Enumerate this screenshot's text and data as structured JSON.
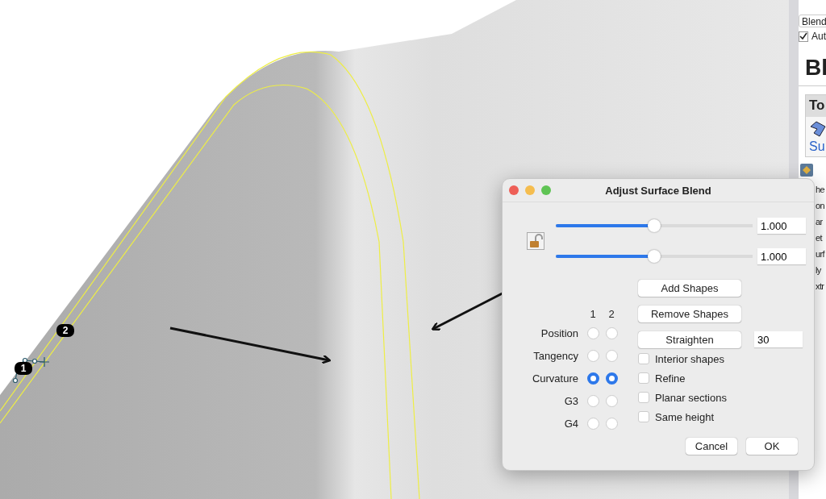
{
  "viewport": {
    "badges": [
      {
        "label": "1"
      },
      {
        "label": "2"
      }
    ]
  },
  "help_panel": {
    "dropdown": "Blend",
    "auto_checkbox": {
      "label": "Aut",
      "checked": true
    },
    "heading": "Bl",
    "toolbox": {
      "title": "To",
      "link": "Su"
    },
    "body_lines": [
      "he",
      "on",
      "ar",
      "et",
      "urf",
      "ly",
      "xtr"
    ]
  },
  "dialog": {
    "title": "Adjust Surface Blend",
    "locked": false,
    "sliders": [
      {
        "level": 0.5,
        "value": "1.000"
      },
      {
        "level": 0.5,
        "value": "1.000"
      }
    ],
    "columns": [
      "1",
      "2"
    ],
    "continuity": [
      {
        "label": "Position",
        "side1": false,
        "side2": false
      },
      {
        "label": "Tangency",
        "side1": false,
        "side2": false
      },
      {
        "label": "Curvature",
        "side1": true,
        "side2": true
      },
      {
        "label": "G3",
        "side1": false,
        "side2": false
      },
      {
        "label": "G4",
        "side1": false,
        "side2": false
      }
    ],
    "add_button": "Add Shapes",
    "remove_button": "Remove Shapes",
    "straighten_button": "Straighten",
    "straighten_value": "30",
    "options": [
      {
        "label": "Interior shapes",
        "checked": false
      },
      {
        "label": "Refine",
        "checked": false
      },
      {
        "label": "Planar sections",
        "checked": false
      },
      {
        "label": "Same height",
        "checked": false
      }
    ],
    "cancel": "Cancel",
    "ok": "OK"
  }
}
